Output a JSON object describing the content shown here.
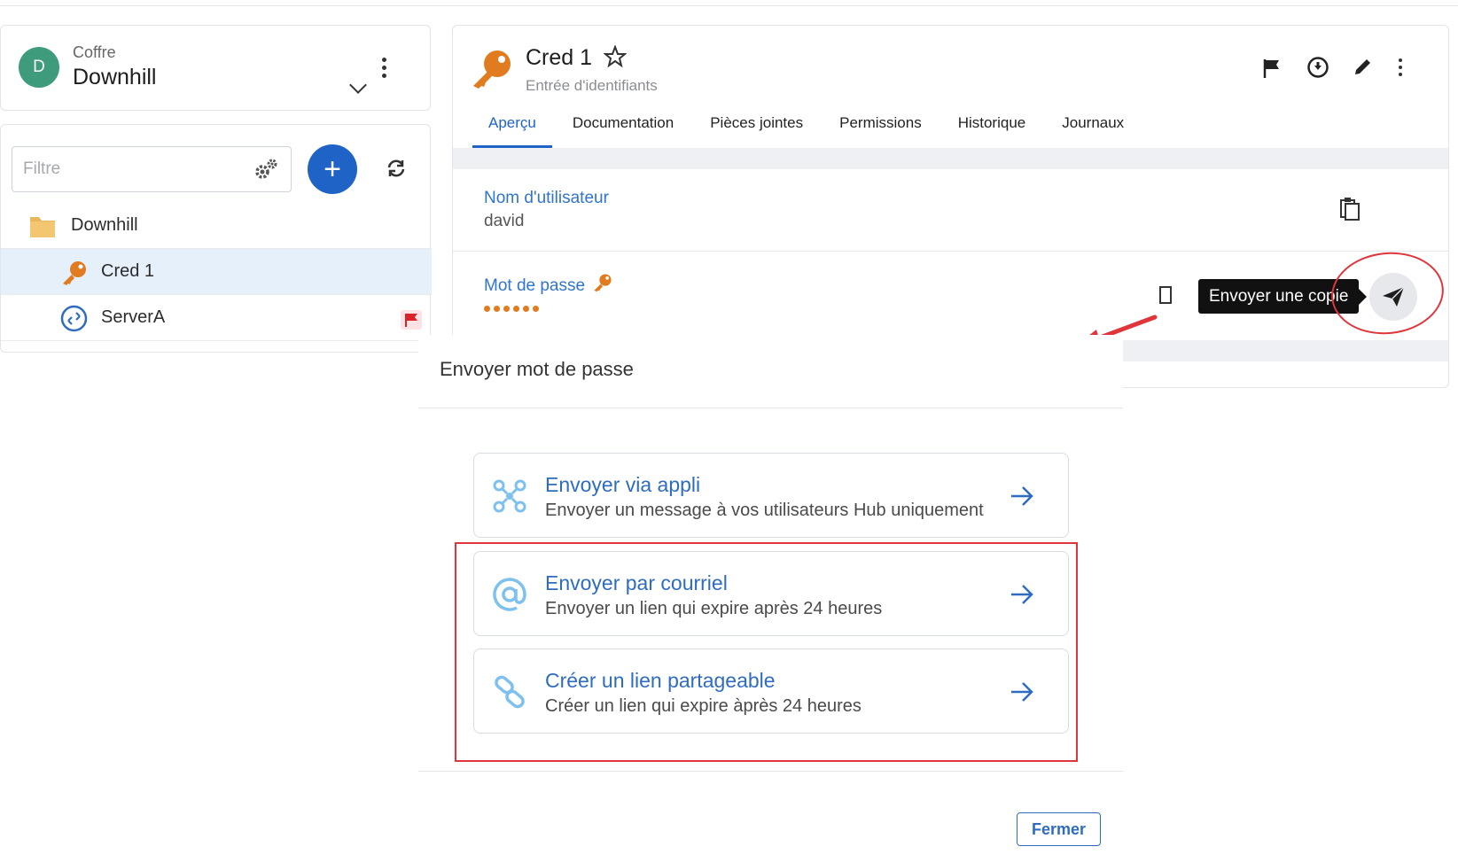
{
  "vault": {
    "avatar_letter": "D",
    "kicker": "Coffre",
    "name": "Downhill"
  },
  "sidebar": {
    "filter_placeholder": "Filtre",
    "tree": [
      {
        "label": "Downhill",
        "icon": "folder-icon"
      },
      {
        "label": "Cred 1",
        "icon": "key-icon",
        "selected": true
      },
      {
        "label": "ServerA",
        "icon": "remote-session-icon",
        "flagged": true
      }
    ]
  },
  "entry": {
    "title": "Cred 1",
    "subtitle": "Entrée d'identifiants",
    "tabs": [
      "Aperçu",
      "Documentation",
      "Pièces jointes",
      "Permissions",
      "Historique",
      "Journaux"
    ],
    "active_tab": "Aperçu",
    "fields": {
      "username_label": "Nom d'utilisateur",
      "username_value": "david",
      "password_label": "Mot de passe",
      "password_mask_length": 6
    },
    "tooltip": "Envoyer une copie"
  },
  "dialog": {
    "title": "Envoyer mot de passe",
    "options": [
      {
        "title": "Envoyer via appli",
        "desc": "Envoyer un message à vos utilisateurs Hub uniquement",
        "icon": "app-network-icon"
      },
      {
        "title": "Envoyer par courriel",
        "desc": "Envoyer un lien qui expire après 24 heures",
        "icon": "at-sign-icon"
      },
      {
        "title": "Créer un lien partageable",
        "desc": "Créer un lien qui expire àprès 24 heures",
        "icon": "link-icon"
      }
    ],
    "close_label": "Fermer"
  },
  "colors": {
    "accent_blue": "#1f63c6",
    "link_blue": "#2f74cf",
    "key_orange": "#e07b1f",
    "annotation_red": "#e0353b",
    "avatar_green": "#3e9b7c"
  }
}
